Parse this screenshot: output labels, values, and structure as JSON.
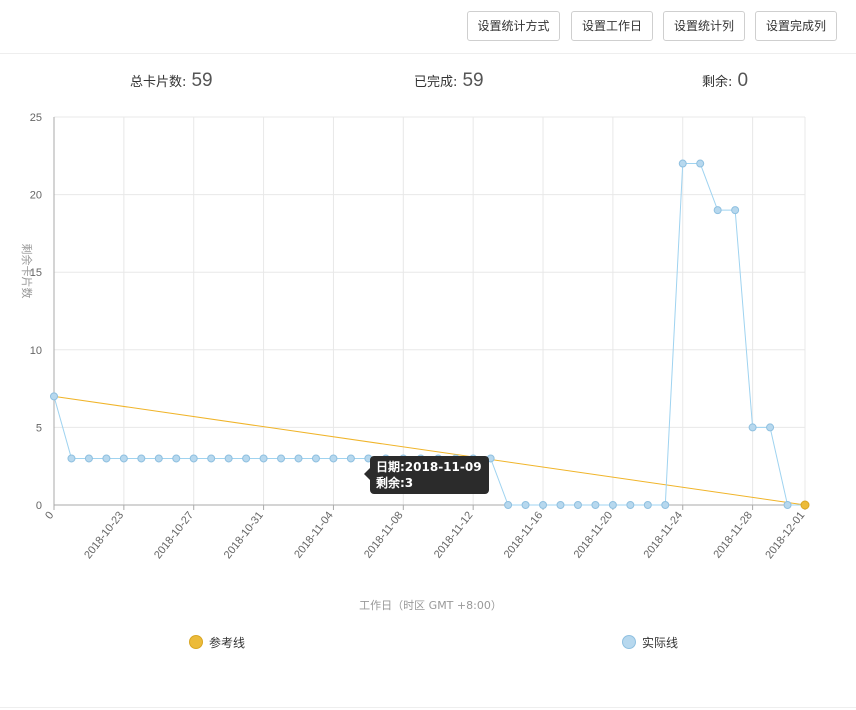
{
  "toolbar": {
    "buttons": [
      "设置统计方式",
      "设置工作日",
      "设置统计列",
      "设置完成列"
    ]
  },
  "stats": {
    "total_label": "总卡片数:",
    "total_value": "59",
    "done_label": "已完成:",
    "done_value": "59",
    "remain_label": "剩余:",
    "remain_value": "0"
  },
  "tooltip": {
    "line1": "日期:2018-11-09",
    "line2": "剩余:3"
  },
  "colors": {
    "reference": "#f0b429",
    "actual": "#9fd3f0",
    "actual_point": "#b7d8ee",
    "grid": "#e8e8e8",
    "axis": "#aaaaaa"
  },
  "chart_data": {
    "type": "line",
    "title": "",
    "xlabel": "工作日（时区 GMT +8:00）",
    "ylabel": "剩余卡片数",
    "ylim": [
      0,
      25
    ],
    "y_ticks": [
      "0",
      "5",
      "10",
      "15",
      "20",
      "25"
    ],
    "x_tick_labels": [
      "0",
      "2018-10-23",
      "2018-10-27",
      "2018-10-31",
      "2018-11-04",
      "2018-11-08",
      "2018-11-12",
      "2018-11-16",
      "2018-11-20",
      "2018-11-24",
      "2018-11-28",
      "2018-12-01"
    ],
    "grid": true,
    "legend_placement": "bottom",
    "series": [
      {
        "name": "参考线",
        "points": [
          [
            0,
            7
          ],
          [
            43,
            0
          ]
        ]
      },
      {
        "name": "实际线",
        "points": [
          [
            0,
            7
          ],
          [
            1,
            3
          ],
          [
            2,
            3
          ],
          [
            3,
            3
          ],
          [
            4,
            3
          ],
          [
            5,
            3
          ],
          [
            6,
            3
          ],
          [
            7,
            3
          ],
          [
            8,
            3
          ],
          [
            9,
            3
          ],
          [
            10,
            3
          ],
          [
            11,
            3
          ],
          [
            12,
            3
          ],
          [
            13,
            3
          ],
          [
            14,
            3
          ],
          [
            15,
            3
          ],
          [
            16,
            3
          ],
          [
            17,
            3
          ],
          [
            18,
            3
          ],
          [
            19,
            3
          ],
          [
            20,
            3
          ],
          [
            21,
            3
          ],
          [
            22,
            3
          ],
          [
            23,
            3
          ],
          [
            24,
            3
          ],
          [
            25,
            3
          ],
          [
            26,
            0
          ],
          [
            27,
            0
          ],
          [
            28,
            0
          ],
          [
            29,
            0
          ],
          [
            30,
            0
          ],
          [
            31,
            0
          ],
          [
            32,
            0
          ],
          [
            33,
            0
          ],
          [
            34,
            0
          ],
          [
            35,
            0
          ],
          [
            36,
            22
          ],
          [
            37,
            22
          ],
          [
            38,
            19
          ],
          [
            39,
            19
          ],
          [
            40,
            5
          ],
          [
            41,
            5
          ],
          [
            42,
            0
          ],
          [
            43,
            0
          ]
        ]
      }
    ]
  }
}
